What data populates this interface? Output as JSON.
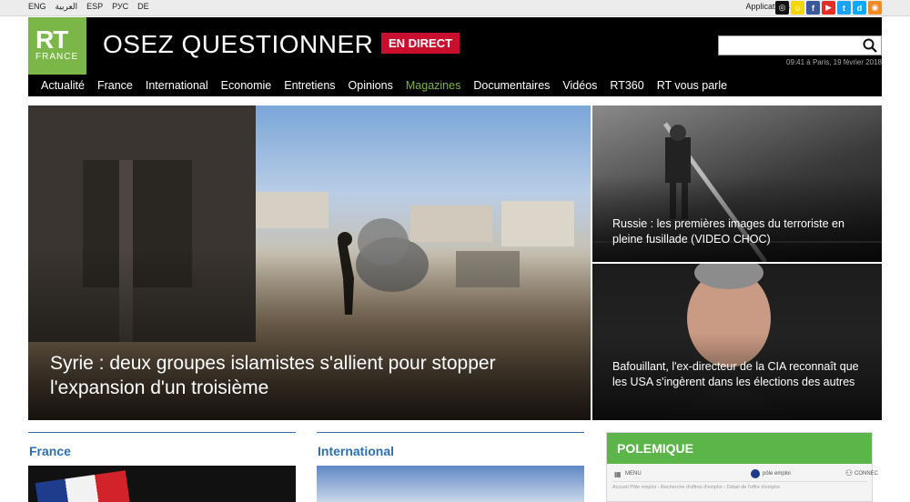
{
  "topbar": {
    "languages": [
      "ENG",
      "العربية",
      "ESP",
      "РУС",
      "DE"
    ],
    "applications": "Applications",
    "social": [
      {
        "icon": "instagram-icon",
        "glyph": "◎",
        "color": "#111111"
      },
      {
        "icon": "snapchat-icon",
        "glyph": "☺",
        "color": "#f2d600"
      },
      {
        "icon": "facebook-icon",
        "glyph": "f",
        "color": "#3b5998"
      },
      {
        "icon": "youtube-icon",
        "glyph": "▶",
        "color": "#e52d27"
      },
      {
        "icon": "twitter-icon",
        "glyph": "t",
        "color": "#1da1f2"
      },
      {
        "icon": "dailymotion-icon",
        "glyph": "d",
        "color": "#00aaff"
      },
      {
        "icon": "rss-icon",
        "glyph": "◉",
        "color": "#f08a24"
      }
    ]
  },
  "header": {
    "logo_rt": "RT",
    "logo_france": "FRANCE",
    "slogan": "OSEZ QUESTIONNER",
    "live_button": "EN DIRECT",
    "search_value": "",
    "datetime": "09:41 à Paris, 19 février 2018"
  },
  "nav": {
    "items": [
      "Actualité",
      "France",
      "International",
      "Economie",
      "Entretiens",
      "Opinions",
      "Magazines",
      "Documentaires",
      "Vidéos",
      "RT360",
      "RT vous parle"
    ],
    "active": "Magazines"
  },
  "articles": {
    "main": "Syrie : deux groupes islamistes s'allient pour stopper l'expansion d'un troisième",
    "side1": "Russie : les premières images du terroriste en pleine fusillade (VIDEO CHOC)",
    "side2": "Bafouillant, l'ex-directeur de la CIA reconnaît que les USA s'ingèrent dans les élections des autres"
  },
  "sections": {
    "france": "France",
    "international": "International",
    "polemique": "POLEMIQUE",
    "polemique_menu": "MENU",
    "polemique_brand": "pôle emploi",
    "polemique_connect": "CONNEC",
    "polemique_crumb": "Accueil Pôle emploi  ›  Recherche d'offres d'emploi  ›  Détail de l'offre d'emploi"
  }
}
